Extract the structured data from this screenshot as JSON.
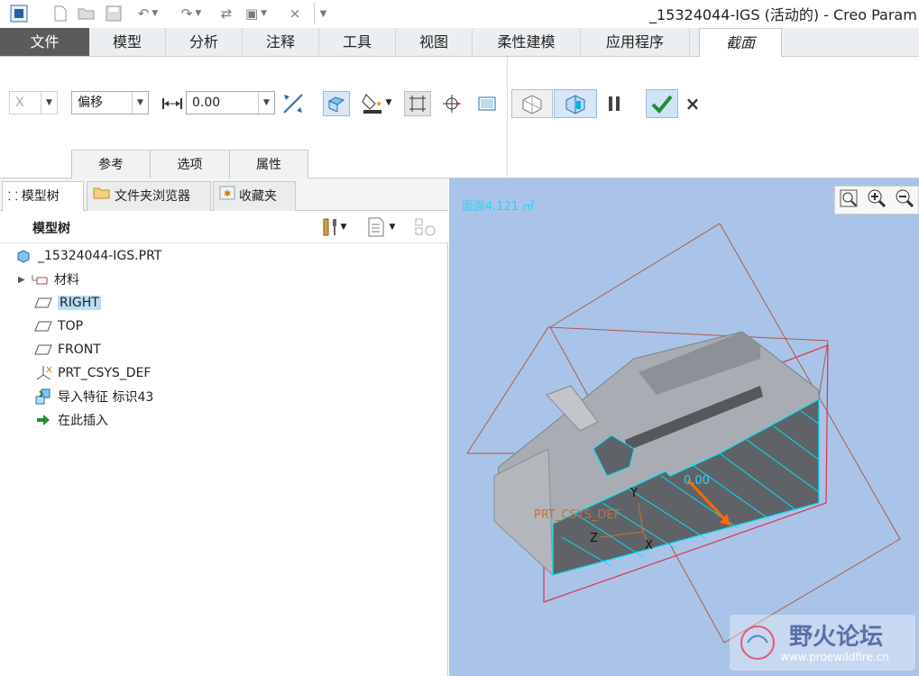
{
  "window": {
    "title": "_15324044-IGS (活动的) - Creo Param"
  },
  "quick_access": [
    "app-icon",
    "new-icon",
    "open-icon",
    "save-icon",
    "undo-icon",
    "redo-icon",
    "regenerate-icon",
    "windows-icon",
    "close-window-icon",
    "customize-icon"
  ],
  "ribbon_tabs": [
    "文件",
    "模型",
    "分析",
    "注释",
    "工具",
    "视图",
    "柔性建模",
    "应用程序",
    "截面"
  ],
  "ribbon": {
    "axis_value": "X",
    "type_value": "偏移",
    "offset_value": "0.00",
    "subtabs": [
      "参考",
      "选项",
      "属性"
    ]
  },
  "panel_tabs": [
    "模型树",
    "文件夹浏览器",
    "收藏夹"
  ],
  "tree_header": "模型树",
  "tree_items": [
    {
      "label": "_15324044-IGS.PRT",
      "icon": "part-icon"
    },
    {
      "label": "材料",
      "icon": "material-icon"
    },
    {
      "label": "RIGHT",
      "icon": "datum-plane-icon"
    },
    {
      "label": "TOP",
      "icon": "datum-plane-icon"
    },
    {
      "label": "FRONT",
      "icon": "datum-plane-icon"
    },
    {
      "label": "PRT_CSYS_DEF",
      "icon": "csys-icon"
    },
    {
      "label": "导入特征 标识43",
      "icon": "import-feature-icon"
    },
    {
      "label": "在此插入",
      "icon": "insert-here-icon"
    }
  ],
  "viewport": {
    "status_text": "面面4.121 ㎡",
    "dim_label": "0.00",
    "csys_label": "PRT_CSYS_DEF",
    "axis_y": "Y",
    "axis_z": "Z",
    "axis_x": "X"
  },
  "watermark": {
    "title": "野火论坛",
    "url": "www.proewildfire.cn"
  },
  "colors": {
    "file_tab": "#5b5b5b",
    "viewport_bg": "#a9c4e8",
    "section_edge": "#00e5ff",
    "plane_line": "#c0504d",
    "selected": "#b9dcf5"
  }
}
